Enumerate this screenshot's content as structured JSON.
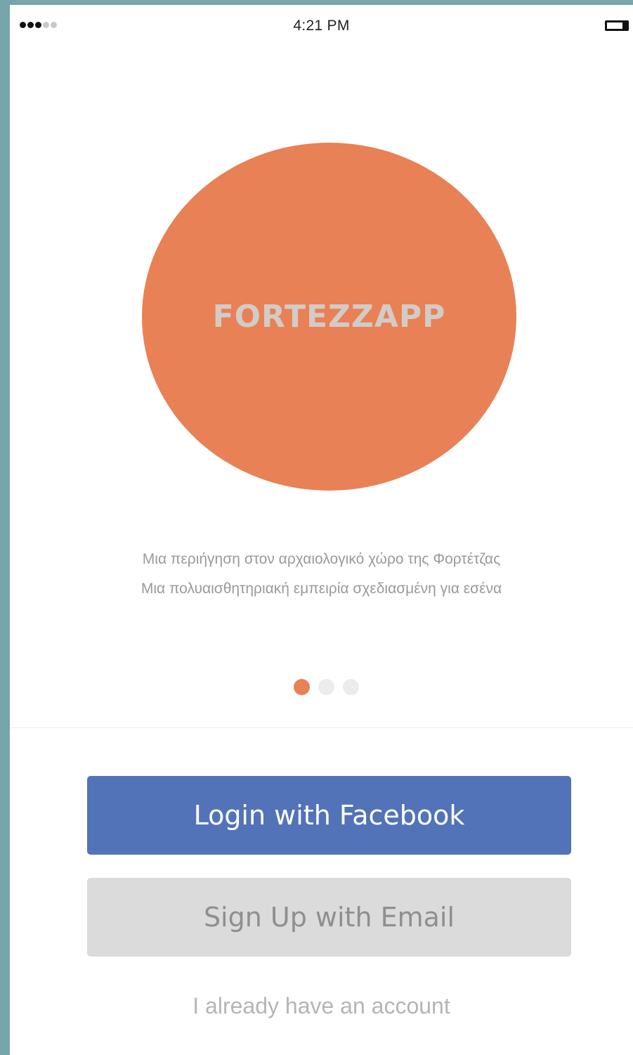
{
  "status_bar": {
    "time": "4:21 PM",
    "signal_strength": 3,
    "signal_max": 5
  },
  "logo": {
    "text": "FORTEZZAPP",
    "circle_color": "#e88155"
  },
  "tagline": {
    "line1": "Μια περιήγηση στον αρχαιολογικό χώρο της Φορτέτζας",
    "line2": "Μια πολυαισθητηριακή εμπειρία σχεδιασμένη για εσένα"
  },
  "pagination": {
    "total": 3,
    "current": 1
  },
  "actions": {
    "facebook_label": "Login with Facebook",
    "email_label": "Sign Up with Email",
    "existing_account_label": "I already have an account"
  },
  "colors": {
    "accent": "#e88155",
    "facebook": "#5273b8",
    "secondary_button": "#dbdbdb",
    "frame_background": "#76a5ac"
  }
}
